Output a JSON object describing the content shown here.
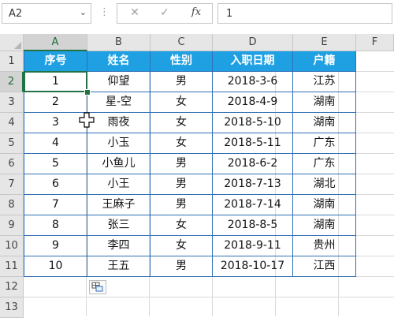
{
  "formula_bar": {
    "name_box": "A2",
    "name_box_arrow": "⌄",
    "separator": "⋮",
    "cancel": "✕",
    "enter": "✓",
    "fx": "fx",
    "value": "1"
  },
  "columns": [
    "A",
    "B",
    "C",
    "D",
    "E",
    "F"
  ],
  "rows": [
    "1",
    "2",
    "3",
    "4",
    "5",
    "6",
    "7",
    "8",
    "9",
    "10",
    "11",
    "12",
    "13"
  ],
  "table": {
    "headers": [
      "序号",
      "姓名",
      "性别",
      "入职日期",
      "户籍"
    ],
    "rows": [
      [
        "1",
        "仰望",
        "男",
        "2018-3-6",
        "江苏"
      ],
      [
        "2",
        "星-空",
        "女",
        "2018-4-9",
        "湖南"
      ],
      [
        "3",
        "雨夜",
        "女",
        "2018-5-10",
        "湖南"
      ],
      [
        "4",
        "小玉",
        "女",
        "2018-5-11",
        "广东"
      ],
      [
        "5",
        "小鱼儿",
        "男",
        "2018-6-2",
        "广东"
      ],
      [
        "6",
        "小王",
        "男",
        "2018-7-13",
        "湖北"
      ],
      [
        "7",
        "王麻子",
        "男",
        "2018-7-14",
        "湖南"
      ],
      [
        "8",
        "张三",
        "女",
        "2018-8-5",
        "湖南"
      ],
      [
        "9",
        "李四",
        "女",
        "2018-9-11",
        "贵州"
      ],
      [
        "10",
        "王五",
        "男",
        "2018-10-17",
        "江西"
      ]
    ]
  },
  "colors": {
    "header_fill": "#1fa0e2",
    "table_border": "#2f6fb5",
    "selection": "#217346"
  }
}
